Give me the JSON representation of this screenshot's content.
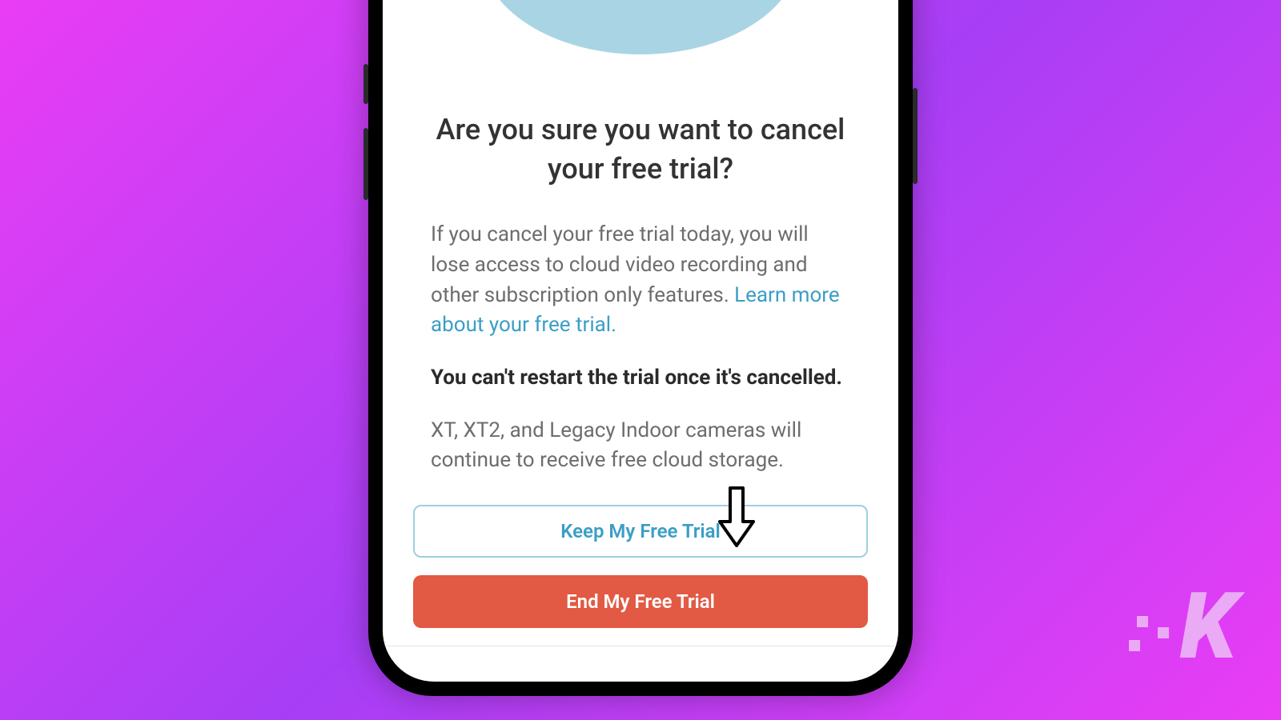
{
  "title": "Are you sure you want to cancel your free trial?",
  "para1_text": "If you cancel your free trial today, you will lose access to cloud video recording and other subscription only features. ",
  "para1_link": "Learn more about your free trial.",
  "bold_warning": "You can't restart the trial once it's cancelled.",
  "para2": "XT, XT2, and Legacy Indoor cameras will continue to receive free cloud storage.",
  "buttons": {
    "keep": "Keep My Free Trial",
    "end": "End My Free Trial"
  }
}
